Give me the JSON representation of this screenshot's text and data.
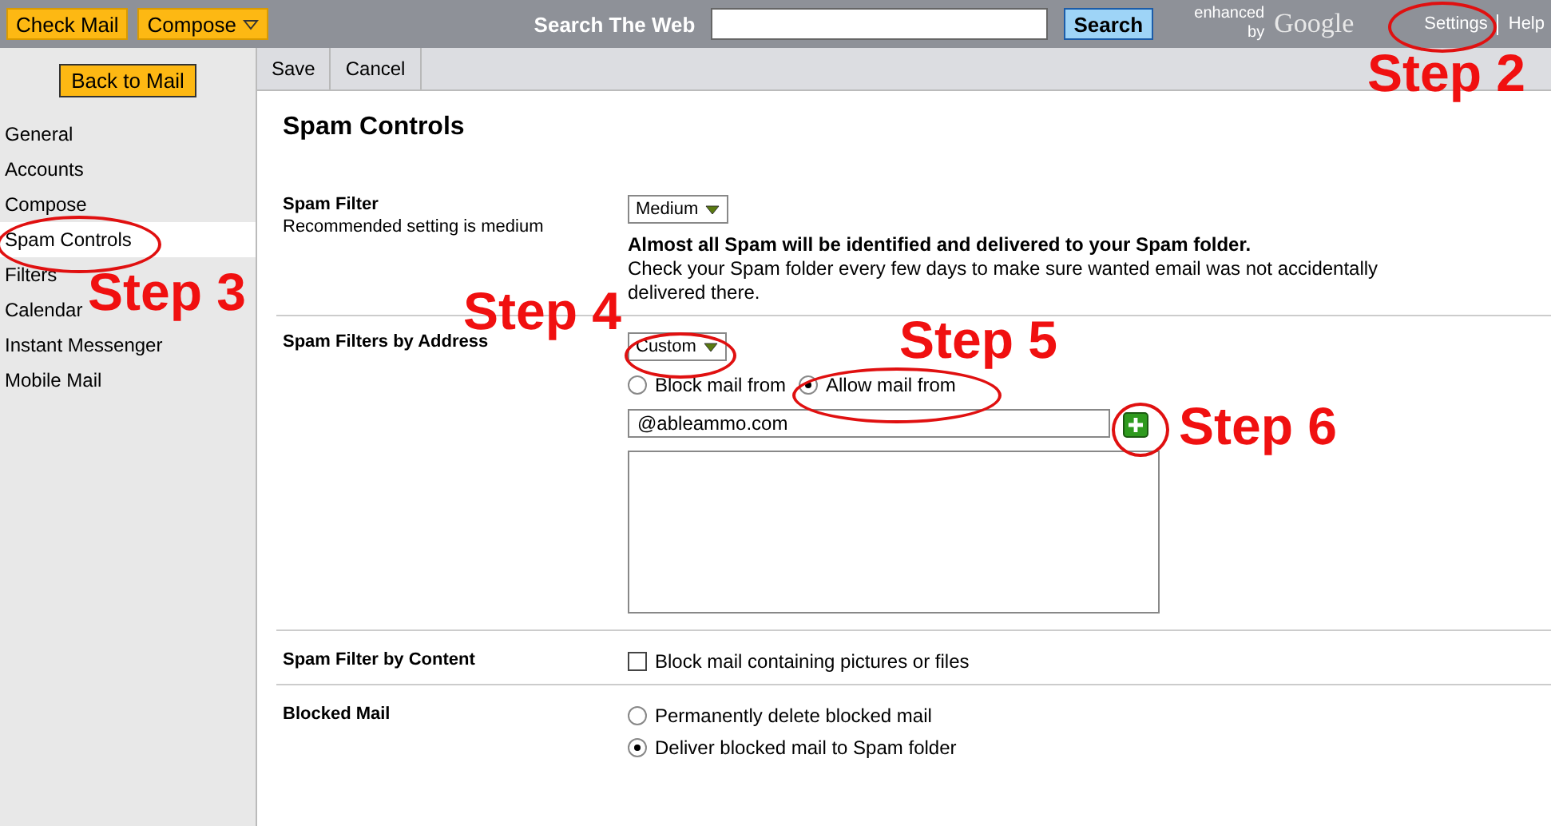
{
  "top_bar": {
    "buttons": [
      {
        "label": "Check Mail",
        "dropdown": false
      },
      {
        "label": "Compose",
        "dropdown": true
      }
    ],
    "search_label": "Search The Web",
    "search_button": "Search",
    "enhanced_by": "enhanced by",
    "logo": "Google",
    "links": [
      "Settings",
      "Help"
    ]
  },
  "sidebar": {
    "back_button": "Back to Mail",
    "items": [
      {
        "label": "General",
        "selected": false
      },
      {
        "label": "Accounts",
        "selected": false
      },
      {
        "label": "Compose",
        "selected": false
      },
      {
        "label": "Spam Controls",
        "selected": true
      },
      {
        "label": "Filters",
        "selected": false
      },
      {
        "label": "Calendar",
        "selected": false
      },
      {
        "label": "Instant Messenger",
        "selected": false
      },
      {
        "label": "Mobile Mail",
        "selected": false
      }
    ]
  },
  "toolbar": [
    "Save",
    "Cancel"
  ],
  "title": "Spam Controls",
  "sections": [
    {
      "kind": "filter",
      "label": "Spam Filter",
      "sublabel": "Recommended setting is medium",
      "select": "Medium",
      "description_bold": "Almost all Spam will be identified and delivered to your Spam folder.",
      "description": "Check your Spam folder every few days to make sure wanted email was not accidentally delivered there."
    },
    {
      "kind": "address",
      "label": "Spam Filters by Address",
      "select": "Custom",
      "radios": [
        {
          "label": "Block mail from",
          "selected": false
        },
        {
          "label": "Allow mail from",
          "selected": true
        }
      ],
      "input_value": "@ableammo.com"
    },
    {
      "kind": "checkbox",
      "label": "Spam Filter by Content",
      "checkbox": {
        "label": "Block mail containing pictures or files",
        "checked": false
      }
    },
    {
      "kind": "radios",
      "label": "Blocked Mail",
      "radios": [
        {
          "label": "Permanently delete blocked mail",
          "selected": false
        },
        {
          "label": "Deliver blocked mail to Spam folder",
          "selected": true
        }
      ]
    }
  ],
  "annotations": [
    "Step 2",
    "Step 3",
    "Step 4",
    "Step 5",
    "Step 6"
  ]
}
